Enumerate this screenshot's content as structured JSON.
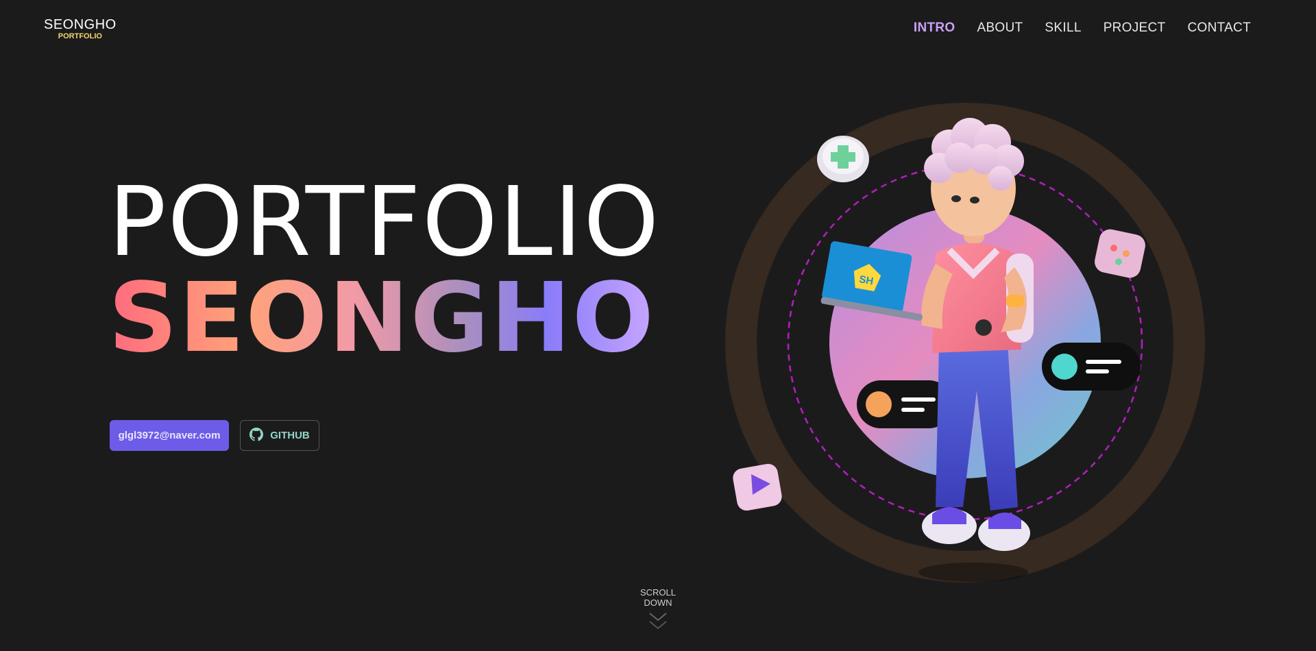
{
  "logo": {
    "main": "SEONGHO",
    "sub": "PORTFOLIO"
  },
  "nav": {
    "items": [
      {
        "label": "INTRO",
        "active": true
      },
      {
        "label": "ABOUT",
        "active": false
      },
      {
        "label": "SKILL",
        "active": false
      },
      {
        "label": "PROJECT",
        "active": false
      },
      {
        "label": "CONTACT",
        "active": false
      }
    ]
  },
  "hero": {
    "line1": "PORTFOLIO",
    "line2": "SEONGHO"
  },
  "buttons": {
    "email_label": "glgl3972@naver.com",
    "github_label": "GITHUB"
  },
  "scroll": {
    "label": "SCROLL DOWN"
  },
  "illustration": {
    "laptop_badge": "SH"
  },
  "colors": {
    "background": "#1c1b1c",
    "accent": "#6c5ce7",
    "nav_active": "#c9a0f5",
    "logo_sub": "#f5d76e",
    "github_text": "#8fd6c8"
  }
}
